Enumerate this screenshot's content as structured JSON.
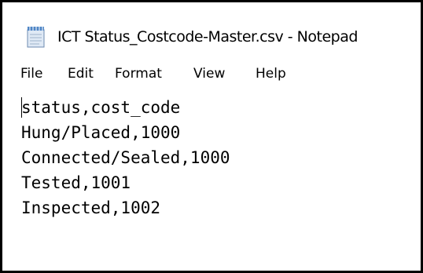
{
  "window": {
    "title": "ICT Status_Costcode-Master.csv - Notepad",
    "icon": "notepad-icon"
  },
  "menu": {
    "items": [
      "File",
      "Edit",
      "Format",
      "View",
      "Help"
    ]
  },
  "editor": {
    "lines": [
      "status,cost_code",
      "Hung/Placed,1000",
      "Connected/Sealed,1000",
      "Tested,1001",
      "Inspected,1002"
    ]
  }
}
